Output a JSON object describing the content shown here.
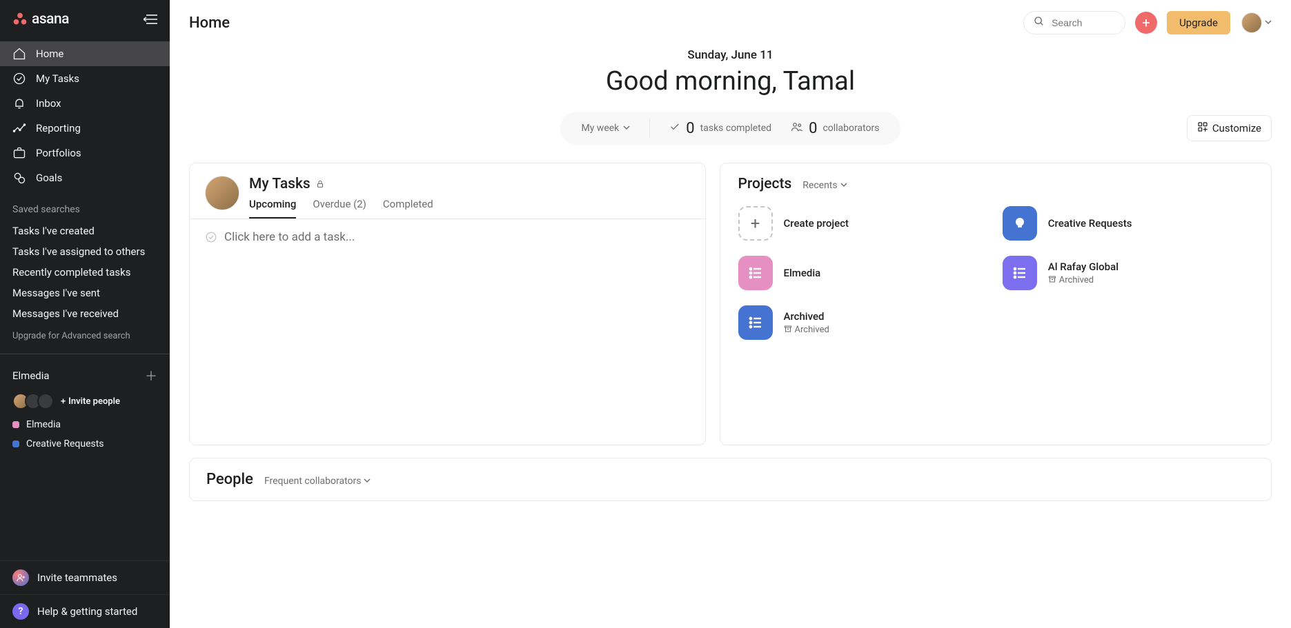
{
  "brand": "asana",
  "sidebar": {
    "nav": [
      {
        "label": "Home"
      },
      {
        "label": "My Tasks"
      },
      {
        "label": "Inbox"
      },
      {
        "label": "Reporting"
      },
      {
        "label": "Portfolios"
      },
      {
        "label": "Goals"
      }
    ],
    "saved_searches_label": "Saved searches",
    "saved_searches": [
      "Tasks I've created",
      "Tasks I've assigned to others",
      "Recently completed tasks",
      "Messages I've sent",
      "Messages I've received"
    ],
    "upgrade_search": "Upgrade for Advanced search",
    "team_name": "Elmedia",
    "invite_people": "Invite people",
    "team_projects": [
      {
        "name": "Elmedia",
        "color": "#e68fc3"
      },
      {
        "name": "Creative Requests",
        "color": "#4573d2"
      }
    ],
    "invite_teammates": "Invite teammates",
    "help": "Help & getting started"
  },
  "topbar": {
    "page_title": "Home",
    "search_placeholder": "Search",
    "upgrade": "Upgrade"
  },
  "hero": {
    "date": "Sunday, June 11",
    "greeting": "Good morning, Tamal"
  },
  "stats": {
    "myweek": "My week",
    "tasks_completed_count": "0",
    "tasks_completed_label": "tasks completed",
    "collaborators_count": "0",
    "collaborators_label": "collaborators",
    "customize": "Customize"
  },
  "mytasks": {
    "title": "My Tasks",
    "tabs": [
      {
        "label": "Upcoming",
        "active": true
      },
      {
        "label": "Overdue (2)",
        "active": false
      },
      {
        "label": "Completed",
        "active": false
      }
    ],
    "add_task_placeholder": "Click here to add a task..."
  },
  "projects": {
    "title": "Projects",
    "filter": "Recents",
    "create_label": "Create project",
    "items": [
      {
        "name": "Creative Requests",
        "color": "#4573d2",
        "icon": "bulb"
      },
      {
        "name": "Elmedia",
        "color": "#e68fc3",
        "icon": "list"
      },
      {
        "name": "Al Rafay Global",
        "color": "#7b6ff0",
        "icon": "list",
        "archived": true
      },
      {
        "name": "Archived",
        "color": "#4573d2",
        "icon": "list",
        "archived": true
      }
    ],
    "archived_label": "Archived"
  },
  "people": {
    "title": "People",
    "filter": "Frequent collaborators"
  }
}
